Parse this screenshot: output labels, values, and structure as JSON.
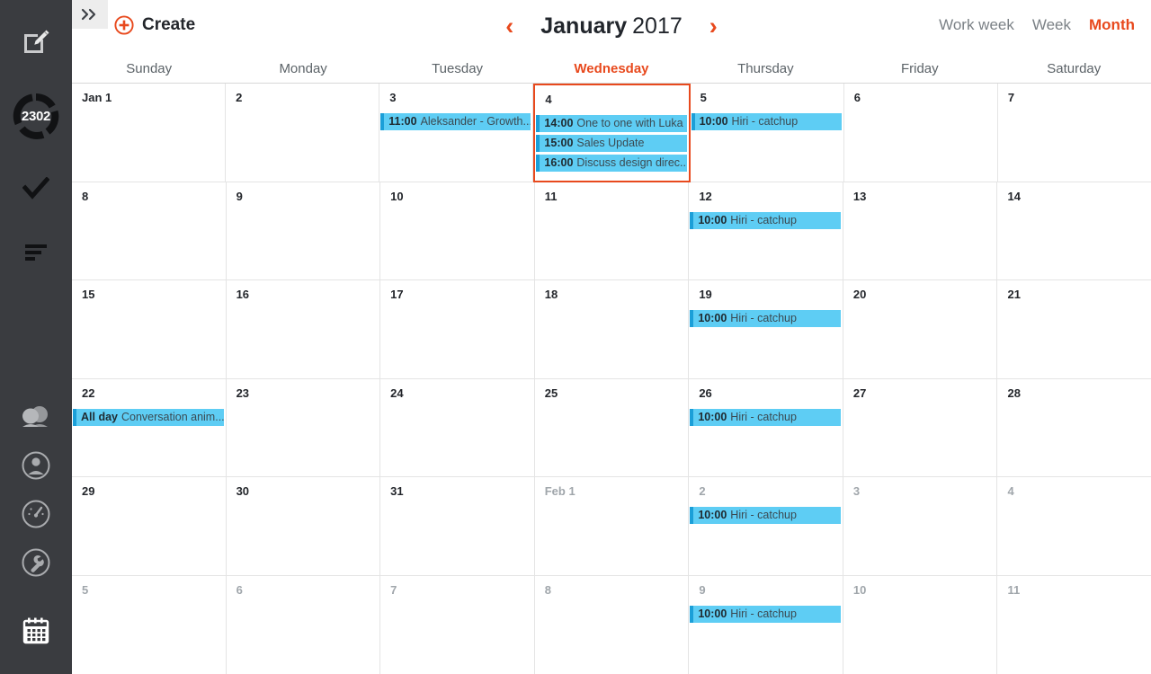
{
  "sidebar": {
    "compose_icon": "compose-pencil-icon",
    "badge_count": "2302",
    "check_icon": "check-icon",
    "lines_icon": "list-lines-icon",
    "people_icon": "people-icon",
    "person_icon": "person-circle-icon",
    "gauge_icon": "gauge-circle-icon",
    "wrench_icon": "wrench-circle-icon",
    "calendar_icon": "calendar-icon"
  },
  "topbar": {
    "expand_icon": "double-chevron-right-icon",
    "create_label": "Create",
    "prev_arrow": "‹",
    "next_arrow": "›",
    "month": "January",
    "year": "2017",
    "views": [
      {
        "label": "Work week",
        "active": false
      },
      {
        "label": "Week",
        "active": false
      },
      {
        "label": "Month",
        "active": true
      }
    ]
  },
  "calendar": {
    "day_headers": [
      {
        "label": "Sunday",
        "today": false
      },
      {
        "label": "Monday",
        "today": false
      },
      {
        "label": "Tuesday",
        "today": false
      },
      {
        "label": "Wednesday",
        "today": true
      },
      {
        "label": "Thursday",
        "today": false
      },
      {
        "label": "Friday",
        "today": false
      },
      {
        "label": "Saturday",
        "today": false
      }
    ],
    "weeks": [
      [
        {
          "day": "Jan 1",
          "other": false,
          "today": false,
          "events": []
        },
        {
          "day": "2",
          "other": false,
          "today": false,
          "events": []
        },
        {
          "day": "3",
          "other": false,
          "today": false,
          "events": [
            {
              "time": "11:00",
              "title": "Aleksander - Growth..."
            }
          ]
        },
        {
          "day": "4",
          "other": false,
          "today": true,
          "events": [
            {
              "time": "14:00",
              "title": "One to one with Luka"
            },
            {
              "time": "15:00",
              "title": "Sales Update"
            },
            {
              "time": "16:00",
              "title": "Discuss design direc..."
            }
          ]
        },
        {
          "day": "5",
          "other": false,
          "today": false,
          "events": [
            {
              "time": "10:00",
              "title": "Hiri - catchup"
            }
          ]
        },
        {
          "day": "6",
          "other": false,
          "today": false,
          "events": []
        },
        {
          "day": "7",
          "other": false,
          "today": false,
          "events": []
        }
      ],
      [
        {
          "day": "8",
          "other": false,
          "today": false,
          "events": []
        },
        {
          "day": "9",
          "other": false,
          "today": false,
          "events": []
        },
        {
          "day": "10",
          "other": false,
          "today": false,
          "events": []
        },
        {
          "day": "11",
          "other": false,
          "today": false,
          "events": []
        },
        {
          "day": "12",
          "other": false,
          "today": false,
          "events": [
            {
              "time": "10:00",
              "title": "Hiri - catchup"
            }
          ]
        },
        {
          "day": "13",
          "other": false,
          "today": false,
          "events": []
        },
        {
          "day": "14",
          "other": false,
          "today": false,
          "events": []
        }
      ],
      [
        {
          "day": "15",
          "other": false,
          "today": false,
          "events": []
        },
        {
          "day": "16",
          "other": false,
          "today": false,
          "events": []
        },
        {
          "day": "17",
          "other": false,
          "today": false,
          "events": []
        },
        {
          "day": "18",
          "other": false,
          "today": false,
          "events": []
        },
        {
          "day": "19",
          "other": false,
          "today": false,
          "events": [
            {
              "time": "10:00",
              "title": "Hiri - catchup"
            }
          ]
        },
        {
          "day": "20",
          "other": false,
          "today": false,
          "events": []
        },
        {
          "day": "21",
          "other": false,
          "today": false,
          "events": []
        }
      ],
      [
        {
          "day": "22",
          "other": false,
          "today": false,
          "events": [
            {
              "time": "All day",
              "title": "Conversation anim..."
            }
          ]
        },
        {
          "day": "23",
          "other": false,
          "today": false,
          "events": []
        },
        {
          "day": "24",
          "other": false,
          "today": false,
          "events": []
        },
        {
          "day": "25",
          "other": false,
          "today": false,
          "events": []
        },
        {
          "day": "26",
          "other": false,
          "today": false,
          "events": [
            {
              "time": "10:00",
              "title": "Hiri - catchup"
            }
          ]
        },
        {
          "day": "27",
          "other": false,
          "today": false,
          "events": []
        },
        {
          "day": "28",
          "other": false,
          "today": false,
          "events": []
        }
      ],
      [
        {
          "day": "29",
          "other": false,
          "today": false,
          "events": []
        },
        {
          "day": "30",
          "other": false,
          "today": false,
          "events": []
        },
        {
          "day": "31",
          "other": false,
          "today": false,
          "events": []
        },
        {
          "day": "Feb 1",
          "other": true,
          "today": false,
          "events": []
        },
        {
          "day": "2",
          "other": true,
          "today": false,
          "events": [
            {
              "time": "10:00",
              "title": "Hiri - catchup"
            }
          ]
        },
        {
          "day": "3",
          "other": true,
          "today": false,
          "events": []
        },
        {
          "day": "4",
          "other": true,
          "today": false,
          "events": []
        }
      ],
      [
        {
          "day": "5",
          "other": true,
          "today": false,
          "events": []
        },
        {
          "day": "6",
          "other": true,
          "today": false,
          "events": []
        },
        {
          "day": "7",
          "other": true,
          "today": false,
          "events": []
        },
        {
          "day": "8",
          "other": true,
          "today": false,
          "events": []
        },
        {
          "day": "9",
          "other": true,
          "today": false,
          "events": [
            {
              "time": "10:00",
              "title": "Hiri - catchup"
            }
          ]
        },
        {
          "day": "10",
          "other": true,
          "today": false,
          "events": []
        },
        {
          "day": "11",
          "other": true,
          "today": false,
          "events": []
        }
      ]
    ]
  },
  "colors": {
    "accent": "#e8491d",
    "sidebar_bg": "#3a3c40",
    "event_bg": "#5ecdf4",
    "event_accent": "#1b9fd8"
  }
}
